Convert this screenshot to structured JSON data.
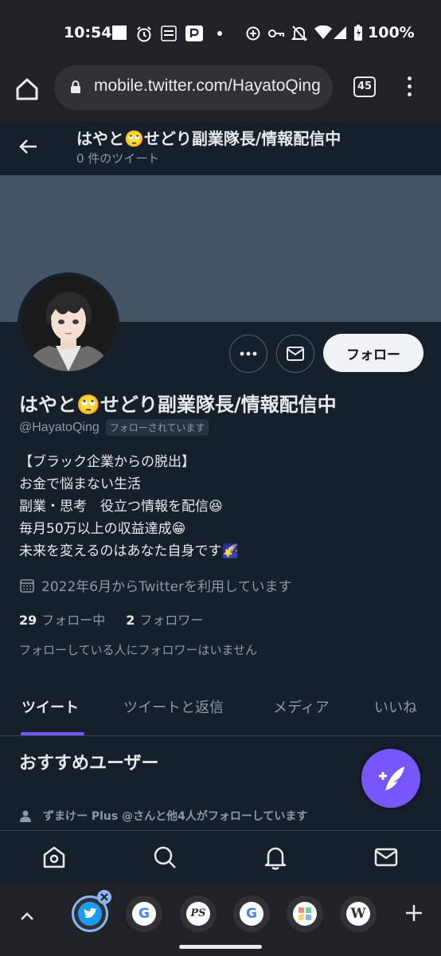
{
  "status_bar": {
    "time": "10:54",
    "battery": "100%",
    "icons": [
      "square-icon",
      "alarm-icon",
      "aeon-mall-icon",
      "paypay-icon",
      "dot-icon",
      "data-saver-icon",
      "key-icon",
      "mute-icon",
      "wifi-icon",
      "signal-icon",
      "battery-icon"
    ]
  },
  "browser": {
    "url": "mobile.twitter.com/HayatoQing",
    "tab_count": "45"
  },
  "header": {
    "name": "はやと🙄せどり副業隊長/情報配信中",
    "tweet_count": "0 件のツイート"
  },
  "profile": {
    "display_name": "はやと🙄せどり副業隊長/情報配信中",
    "handle": "@HayatoQing",
    "follows_you": "フォローされています",
    "follow_button": "フォロー",
    "bio": [
      "【ブラック企業からの脱出】",
      "お金で悩まない生活",
      "副業・思考　役立つ情報を配信😆",
      "毎月50万以上の収益達成😁",
      "未来を変えるのはあなた自身です🌠"
    ],
    "joined": "2022年6月からTwitterを利用しています",
    "following_count": "29",
    "following_label": "フォロー中",
    "followers_count": "2",
    "followers_label": "フォロワー",
    "mutual_note": "フォローしている人にフォロワーはいません"
  },
  "tabs": [
    "ツイート",
    "ツイートと返信",
    "メディア",
    "いいね"
  ],
  "active_tab": "ツイート",
  "recommend": {
    "title": "おすすめユーザー",
    "social_context": "ずまけー Plus @さんと他4人がフォローしています"
  },
  "bottom_nav": [
    "home-icon",
    "search-icon",
    "notifications-icon",
    "messages-icon"
  ],
  "tab_strip": {
    "items": [
      "twitter",
      "google",
      "PS",
      "google",
      "app",
      "W"
    ],
    "google_letter": "G",
    "ps_letter": "PS",
    "wiki_letter": "W"
  },
  "colors": {
    "background": "#15202b",
    "banner": "#425466",
    "accent": "#7856ff",
    "text_secondary": "#8b98a5"
  }
}
